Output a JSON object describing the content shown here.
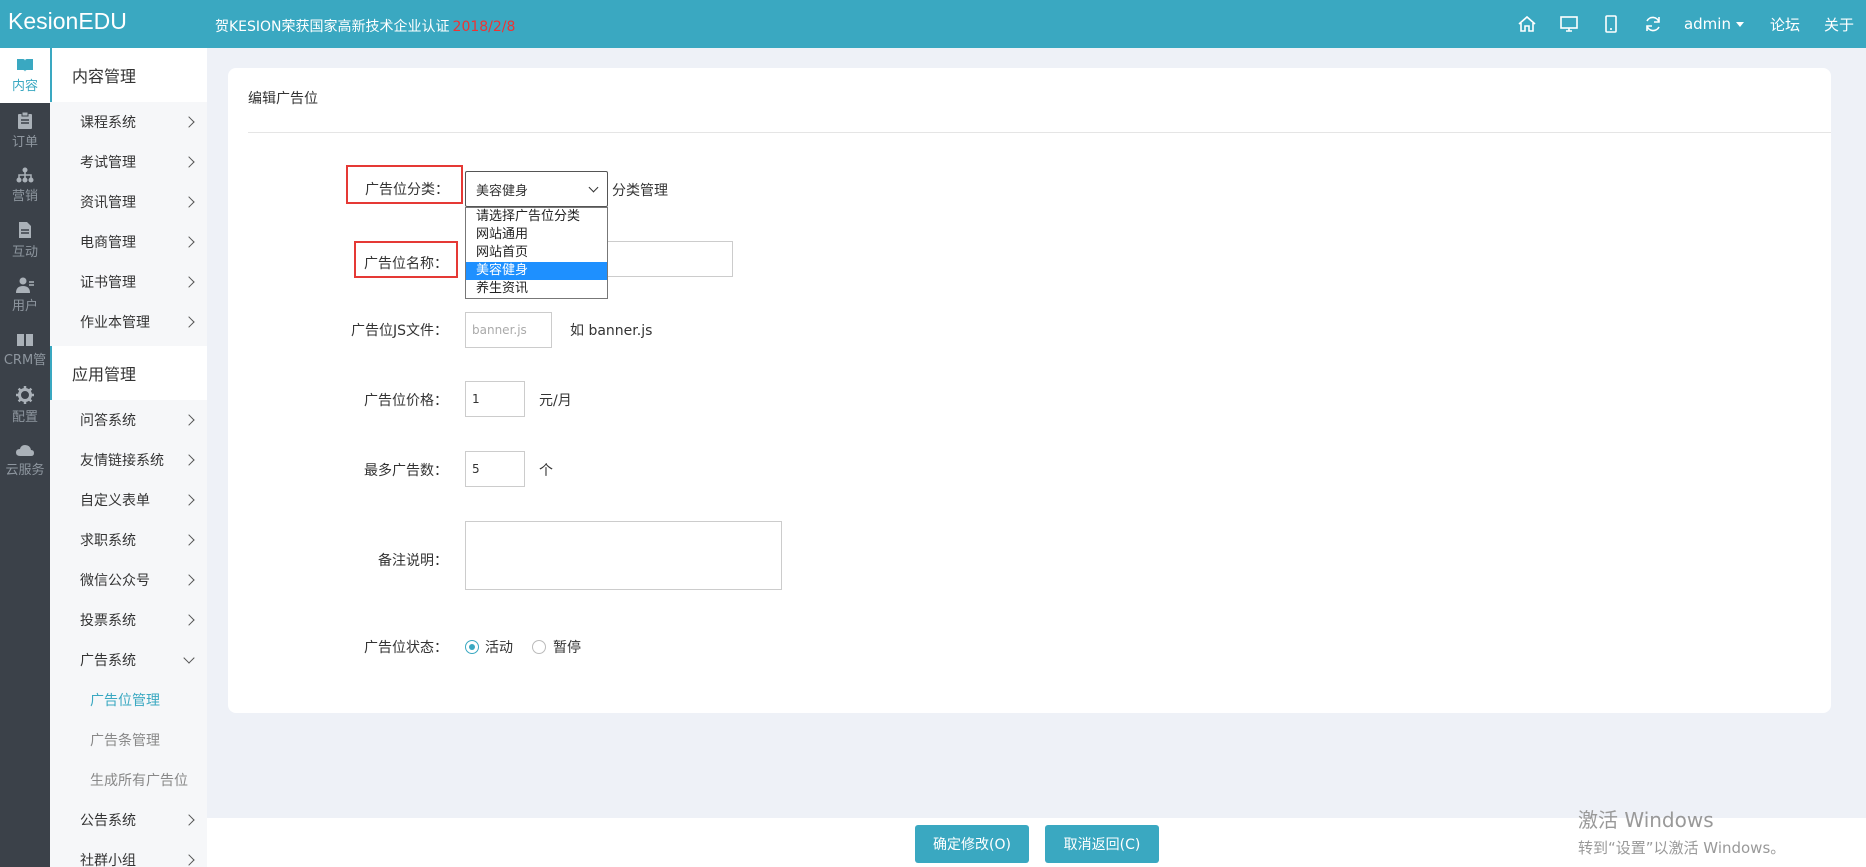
{
  "header": {
    "logo": "KesionEDU",
    "announcement": "贺KESION荣获国家高新技术企业认证",
    "announcement_date": "2018/2/8",
    "user": "admin",
    "links": [
      "论坛",
      "关于"
    ],
    "icons": [
      "home-icon",
      "desktop-icon",
      "mobile-icon",
      "refresh-icon"
    ]
  },
  "rail": [
    {
      "label": "内容",
      "icon": "book-icon",
      "active": true
    },
    {
      "label": "订单",
      "icon": "clipboard-icon"
    },
    {
      "label": "营销",
      "icon": "sitemap-icon"
    },
    {
      "label": "互动",
      "icon": "document-icon"
    },
    {
      "label": "用户",
      "icon": "user-icon"
    },
    {
      "label": "CRM管",
      "icon": "open-book-icon"
    },
    {
      "label": "配置",
      "icon": "gear-icon"
    },
    {
      "label": "云服务",
      "icon": "cloud-icon"
    }
  ],
  "sidebar": {
    "content_title": "内容管理",
    "content_items": [
      "课程系统",
      "考试管理",
      "资讯管理",
      "电商管理",
      "证书管理",
      "作业本管理"
    ],
    "app_title": "应用管理",
    "app_items": [
      "问答系统",
      "友情链接系统",
      "自定义表单",
      "求职系统",
      "微信公众号",
      "投票系统",
      "广告系统"
    ],
    "ad_sub": [
      "广告位管理",
      "广告条管理",
      "生成所有广告位"
    ],
    "after_items": [
      "公告系统",
      "社群小组"
    ]
  },
  "form": {
    "title": "编辑广告位",
    "category_label": "广告位分类：",
    "category_selected": "美容健身",
    "category_link": "分类管理",
    "category_options": [
      "请选择广告位分类",
      "网站通用",
      "网站首页",
      "美容健身",
      "养生资讯"
    ],
    "name_label": "广告位名称：",
    "js_label": "广告位JS文件：",
    "js_placeholder": "banner.js",
    "js_hint": "如 banner.js",
    "price_label": "广告位价格：",
    "price_value": "1",
    "price_unit": "元/月",
    "max_label": "最多广告数：",
    "max_value": "5",
    "max_unit": "个",
    "note_label": "备注说明：",
    "status_label": "广告位状态：",
    "status_active": "活动",
    "status_paused": "暂停"
  },
  "footer": {
    "confirm": "确定修改(O)",
    "cancel": "取消返回(C)"
  },
  "watermark": {
    "line1": "激活 Windows",
    "line2": "转到“设置”以激活 Windows。"
  },
  "colors": {
    "accent": "#3aa8c1",
    "highlight": "#e53935",
    "selected_option": "#1e90ff"
  }
}
